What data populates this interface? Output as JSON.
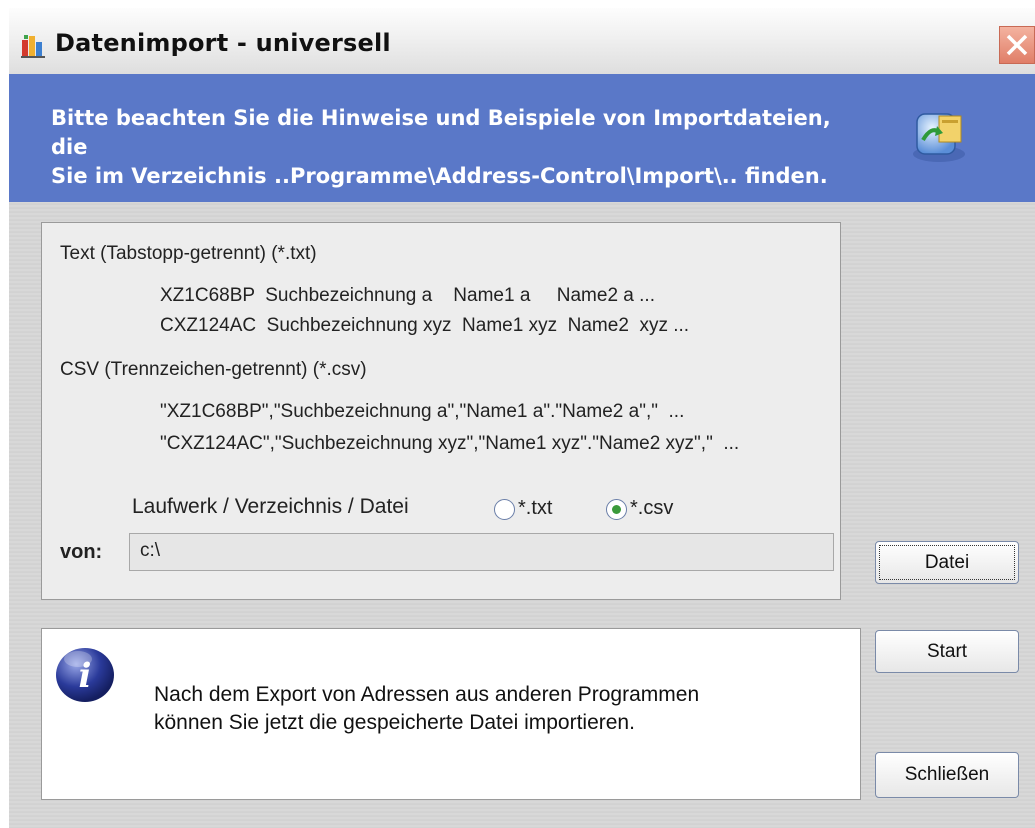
{
  "window": {
    "title": "Datenimport - universell",
    "icon": "app-icon",
    "close_icon": "close-icon"
  },
  "banner": {
    "line1": "Bitte beachten Sie die Hinweise und Beispiele von Importdateien, die",
    "line2": "Sie im Verzeichnis ..Programme\\Address-Control\\Import\\.. finden.",
    "icon": "import-wizard-icon",
    "bg_color": "#5a78c8"
  },
  "formats": {
    "txt": {
      "heading": "Text (Tabstopp-getrennt) (*.txt)",
      "example1": "XZ1C68BP  Suchbezeichnung a    Name1 a     Name2 a ...",
      "example2": "CXZ124AC  Suchbezeichnung xyz  Name1 xyz  Name2  xyz ..."
    },
    "csv": {
      "heading": "CSV (Trennzeichen-getrennt) (*.csv)",
      "example1": "\"XZ1C68BP\",\"Suchbezeichnung a\",\"Name1 a\".\"Name2 a\",\"  ...",
      "example2": "\"CXZ124AC\",\"Suchbezeichnung xyz\",\"Name1 xyz\".\"Name2 xyz\",\"  ..."
    }
  },
  "source": {
    "label": "Laufwerk / Verzeichnis / Datei",
    "radio_txt_label": "*.txt",
    "radio_csv_label": "*.csv",
    "selected": "csv",
    "from_label": "von:",
    "path_value": "c:\\"
  },
  "buttons": {
    "file_label": "Datei",
    "start_label": "Start",
    "close_label": "Schließen"
  },
  "info": {
    "icon": "info-icon",
    "line1": "Nach dem Export von Adressen aus anderen Programmen",
    "line2": "können Sie jetzt die gespeicherte Datei importieren."
  }
}
